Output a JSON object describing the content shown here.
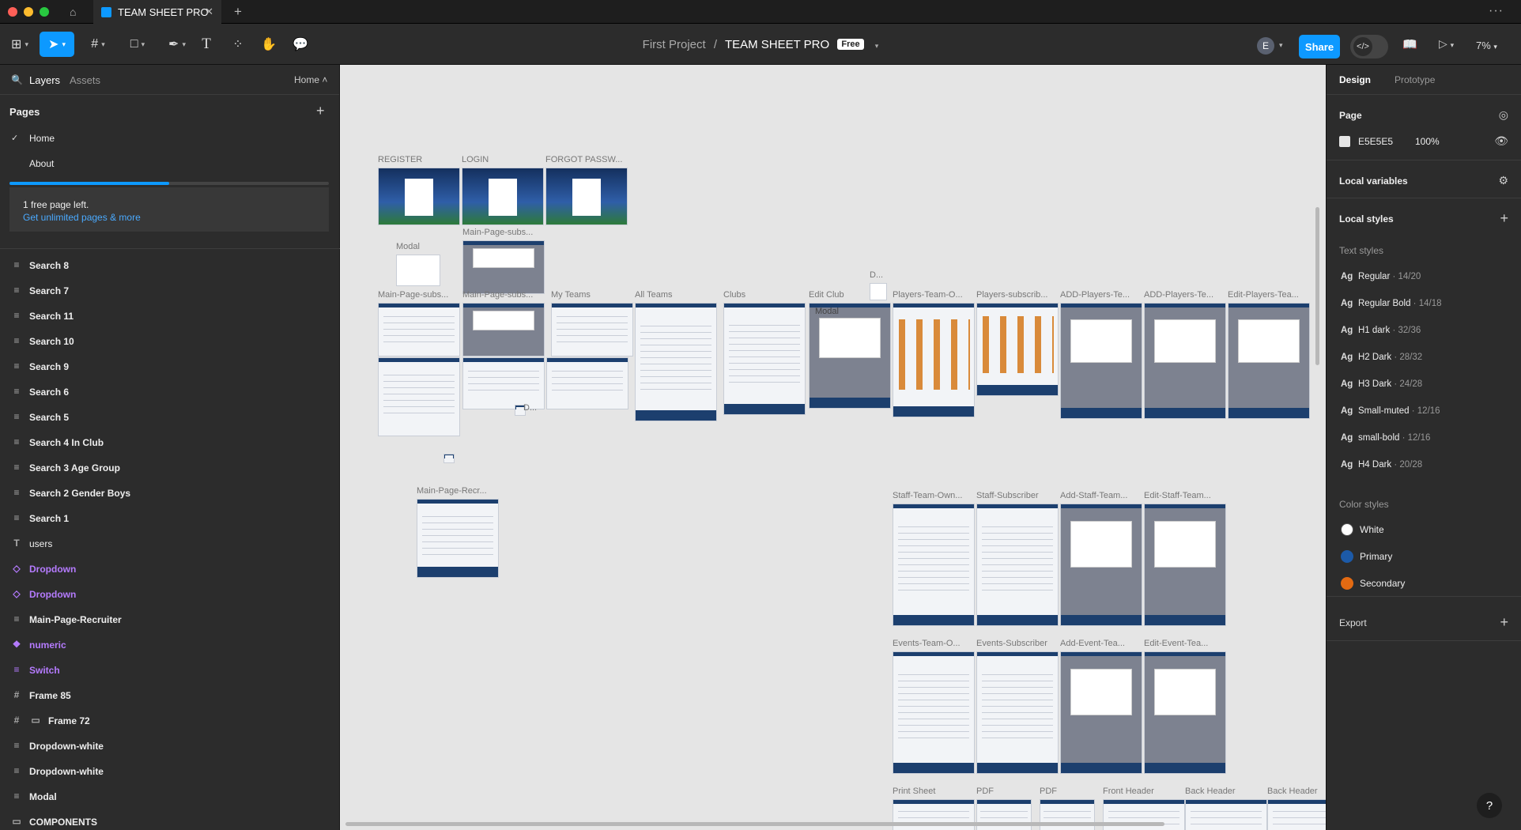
{
  "window": {
    "tab_title": "TEAM SHEET PRO"
  },
  "toolbar": {
    "zoom": "7%",
    "share": "Share"
  },
  "breadcrumb": {
    "project": "First Project",
    "sep": "/",
    "file": "TEAM SHEET PRO",
    "plan": "Free"
  },
  "user": {
    "initial": "E"
  },
  "left": {
    "tabs": {
      "layers": "Layers",
      "assets": "Assets",
      "page_select": "Home ˄"
    },
    "pages_title": "Pages",
    "pages": [
      {
        "label": "Home",
        "current": true
      },
      {
        "label": "About",
        "current": false
      }
    ],
    "page_quota_fraction": 0.5,
    "upsell": {
      "text": "1 free page left.",
      "link": "Get unlimited pages & more"
    },
    "layers": [
      {
        "name": "Search 8",
        "icon": "frame-lines-icon"
      },
      {
        "name": "Search 7",
        "icon": "frame-lines-icon"
      },
      {
        "name": "Search 11",
        "icon": "frame-lines-icon"
      },
      {
        "name": "Search 10",
        "icon": "frame-lines-icon"
      },
      {
        "name": "Search 9",
        "icon": "frame-lines-icon"
      },
      {
        "name": "Search 6",
        "icon": "frame-lines-icon"
      },
      {
        "name": "Search 5",
        "icon": "frame-lines-icon"
      },
      {
        "name": "Search 4 In Club",
        "icon": "frame-lines-icon"
      },
      {
        "name": "Search 3 Age Group",
        "icon": "frame-lines-icon"
      },
      {
        "name": "Search 2 Gender Boys",
        "icon": "frame-lines-icon"
      },
      {
        "name": "Search 1",
        "icon": "frame-lines-icon"
      },
      {
        "name": "users",
        "icon": "text-icon"
      },
      {
        "name": "Dropdown",
        "icon": "component-instance-icon",
        "component": true
      },
      {
        "name": "Dropdown",
        "icon": "component-instance-icon",
        "component": true
      },
      {
        "name": "Main-Page-Recruiter",
        "icon": "frame-lines-icon"
      },
      {
        "name": "numeric",
        "icon": "component-set-icon",
        "component": true
      },
      {
        "name": "Switch",
        "icon": "frame-lines-icon",
        "component": true
      },
      {
        "name": "Frame 85",
        "icon": "frame-hash-icon"
      },
      {
        "name": "Frame 72",
        "icon": "frame-hash-icon",
        "indent": true
      },
      {
        "name": "Dropdown-white",
        "icon": "frame-lines-icon"
      },
      {
        "name": "Dropdown-white",
        "icon": "frame-lines-icon"
      },
      {
        "name": "Modal",
        "icon": "frame-lines-icon"
      },
      {
        "name": "COMPONENTS",
        "icon": "section-icon"
      }
    ]
  },
  "right": {
    "tabs": {
      "design": "Design",
      "prototype": "Prototype"
    },
    "page_title": "Page",
    "page_fill": {
      "hex": "E5E5E5",
      "opacity": "100%"
    },
    "local_variables": "Local variables",
    "local_styles": "Local styles",
    "text_styles_title": "Text styles",
    "text_styles": [
      {
        "ag": "Ag",
        "name": "Regular",
        "meta": " · 14/20"
      },
      {
        "ag": "Ag",
        "name": "Regular Bold",
        "meta": " · 14/18"
      },
      {
        "ag": "Ag",
        "name": "H1 dark",
        "meta": " · 32/36"
      },
      {
        "ag": "Ag",
        "name": "H2 Dark",
        "meta": " · 28/32"
      },
      {
        "ag": "Ag",
        "name": "H3 Dark",
        "meta": " · 24/28"
      },
      {
        "ag": "Ag",
        "name": "Small-muted",
        "meta": " · 12/16"
      },
      {
        "ag": "Ag",
        "name": "small-bold",
        "meta": " · 12/16"
      },
      {
        "ag": "Ag",
        "name": "H4 Dark",
        "meta": " · 20/28"
      }
    ],
    "color_styles_title": "Color styles",
    "color_styles": [
      {
        "name": "White",
        "color": "#ffffff"
      },
      {
        "name": "Primary",
        "color": "#1c5aa8"
      },
      {
        "name": "Secondary",
        "color": "#e36a12"
      }
    ],
    "export": "Export"
  },
  "canvas": {
    "background": "#E5E5E5",
    "frames": [
      {
        "label": "REGISTER",
        "kind": "stadium"
      },
      {
        "label": "LOGIN",
        "kind": "stadium"
      },
      {
        "label": "FORGOT PASSW...",
        "kind": "stadium"
      },
      {
        "label": "Main-Page-subs...",
        "kind": "dark"
      },
      {
        "label": "Modal",
        "kind": "small"
      },
      {
        "label": "Main-Page-subs...",
        "kind": "light"
      },
      {
        "label": "Main-Page-subs...",
        "kind": "dark"
      },
      {
        "label": "My Teams",
        "kind": "light"
      },
      {
        "label": "All Teams",
        "kind": "light"
      },
      {
        "label": "Clubs",
        "kind": "light"
      },
      {
        "label": "Edit Club",
        "kind": "dark"
      },
      {
        "label": "D...",
        "kind": "small"
      },
      {
        "label": "Players-Team-O...",
        "kind": "cards"
      },
      {
        "label": "Players-subscrib...",
        "kind": "cards"
      },
      {
        "label": "ADD-Players-Te...",
        "kind": "dark"
      },
      {
        "label": "ADD-Players-Te...",
        "kind": "dark"
      },
      {
        "label": "Edit-Players-Tea...",
        "kind": "dark"
      },
      {
        "label": "Main-Page-Recr...",
        "kind": "light"
      },
      {
        "label": "Staff-Team-Own...",
        "kind": "light"
      },
      {
        "label": "Staff-Subscriber",
        "kind": "light"
      },
      {
        "label": "Add-Staff-Team...",
        "kind": "dark"
      },
      {
        "label": "Edit-Staff-Team...",
        "kind": "dark"
      },
      {
        "label": "Events-Team-O...",
        "kind": "light"
      },
      {
        "label": "Events-Subscriber",
        "kind": "light"
      },
      {
        "label": "Add-Event-Tea...",
        "kind": "dark"
      },
      {
        "label": "Edit-Event-Tea...",
        "kind": "dark"
      },
      {
        "label": "Print Sheet",
        "kind": "light"
      },
      {
        "label": "PDF",
        "kind": "light"
      },
      {
        "label": "PDF",
        "kind": "light"
      },
      {
        "label": "Front Header",
        "kind": "light"
      },
      {
        "label": "Back Header",
        "kind": "light"
      },
      {
        "label": "Back Header",
        "kind": "light"
      }
    ],
    "frame_badges": {
      "edit_club_modal": "Modal",
      "small_d": "D..."
    }
  }
}
